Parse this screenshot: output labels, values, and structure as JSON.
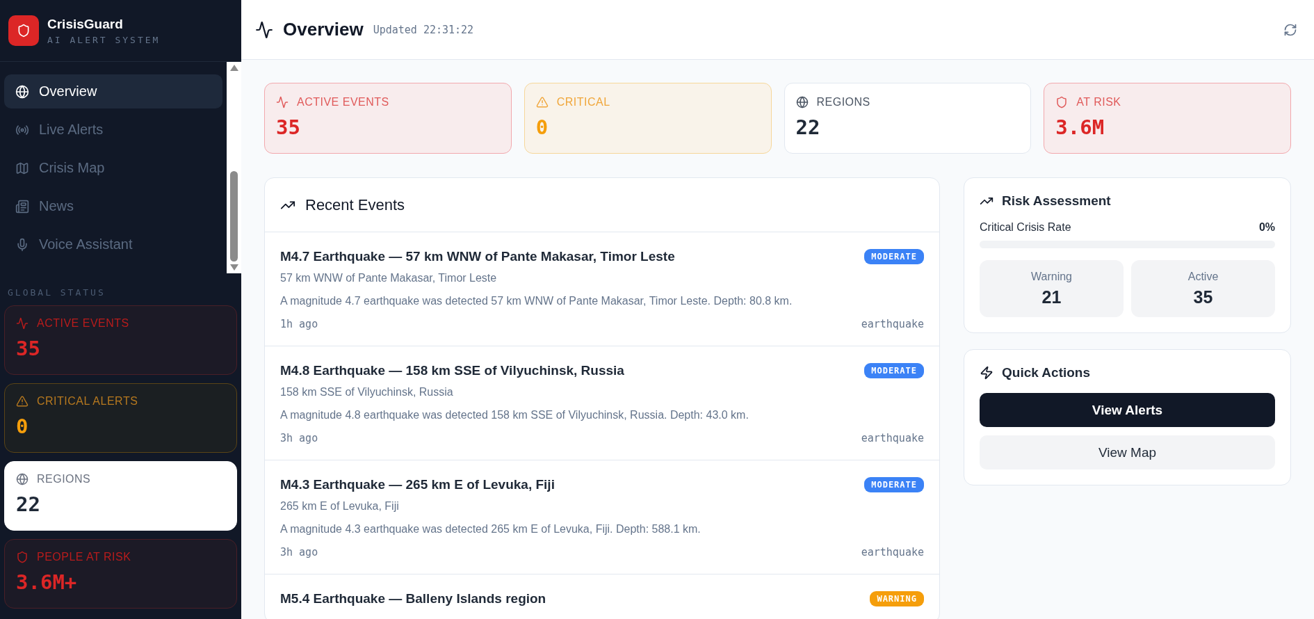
{
  "brand": {
    "name": "CrisisGuard",
    "tagline": "AI ALERT SYSTEM"
  },
  "nav": [
    {
      "label": "Overview",
      "selected": true
    },
    {
      "label": "Live Alerts",
      "selected": false
    },
    {
      "label": "Crisis Map",
      "selected": false
    },
    {
      "label": "News",
      "selected": false
    },
    {
      "label": "Voice Assistant",
      "selected": false
    }
  ],
  "global_status": {
    "heading": "GLOBAL STATUS",
    "cards": [
      {
        "label": "ACTIVE EVENTS",
        "value": "35",
        "kind": "danger"
      },
      {
        "label": "CRITICAL ALERTS",
        "value": "0",
        "kind": "warning"
      },
      {
        "label": "REGIONS",
        "value": "22",
        "kind": "neutral"
      },
      {
        "label": "PEOPLE AT RISK",
        "value": "3.6M+",
        "kind": "danger"
      }
    ]
  },
  "header": {
    "title": "Overview",
    "updated": "Updated 22:31:22"
  },
  "stats": [
    {
      "label": "ACTIVE EVENTS",
      "value": "35",
      "kind": "danger"
    },
    {
      "label": "CRITICAL",
      "value": "0",
      "kind": "warning"
    },
    {
      "label": "REGIONS",
      "value": "22",
      "kind": "neutral"
    },
    {
      "label": "AT RISK",
      "value": "3.6M",
      "kind": "danger"
    }
  ],
  "recent_events": {
    "title": "Recent Events",
    "items": [
      {
        "title": "M4.7 Earthquake — 57 km WNW of Pante Makasar, Timor Leste",
        "location": "57 km WNW of Pante Makasar, Timor Leste",
        "description": "A magnitude 4.7 earthquake was detected 57 km WNW of Pante Makasar, Timor Leste. Depth: 80.8 km.",
        "time": "1h ago",
        "category": "earthquake",
        "badge": "MODERATE",
        "kind": "moderate"
      },
      {
        "title": "M4.8 Earthquake — 158 km SSE of Vilyuchinsk, Russia",
        "location": "158 km SSE of Vilyuchinsk, Russia",
        "description": "A magnitude 4.8 earthquake was detected 158 km SSE of Vilyuchinsk, Russia. Depth: 43.0 km.",
        "time": "3h ago",
        "category": "earthquake",
        "badge": "MODERATE",
        "kind": "moderate"
      },
      {
        "title": "M4.3 Earthquake — 265 km E of Levuka, Fiji",
        "location": "265 km E of Levuka, Fiji",
        "description": "A magnitude 4.3 earthquake was detected 265 km E of Levuka, Fiji. Depth: 588.1 km.",
        "time": "3h ago",
        "category": "earthquake",
        "badge": "MODERATE",
        "kind": "moderate"
      },
      {
        "title": "M5.4 Earthquake — Balleny Islands region",
        "badge": "WARNING",
        "kind": "warning"
      }
    ]
  },
  "risk_assessment": {
    "title": "Risk Assessment",
    "rate_label": "Critical Crisis Rate",
    "rate_value": "0%",
    "level": 0,
    "tiles": [
      {
        "label": "Warning",
        "value": "21"
      },
      {
        "label": "Active",
        "value": "35"
      }
    ]
  },
  "quick_actions": {
    "title": "Quick Actions",
    "buttons": [
      {
        "label": "View Alerts",
        "kind": "primary"
      },
      {
        "label": "View Map",
        "kind": "secondary"
      }
    ]
  }
}
